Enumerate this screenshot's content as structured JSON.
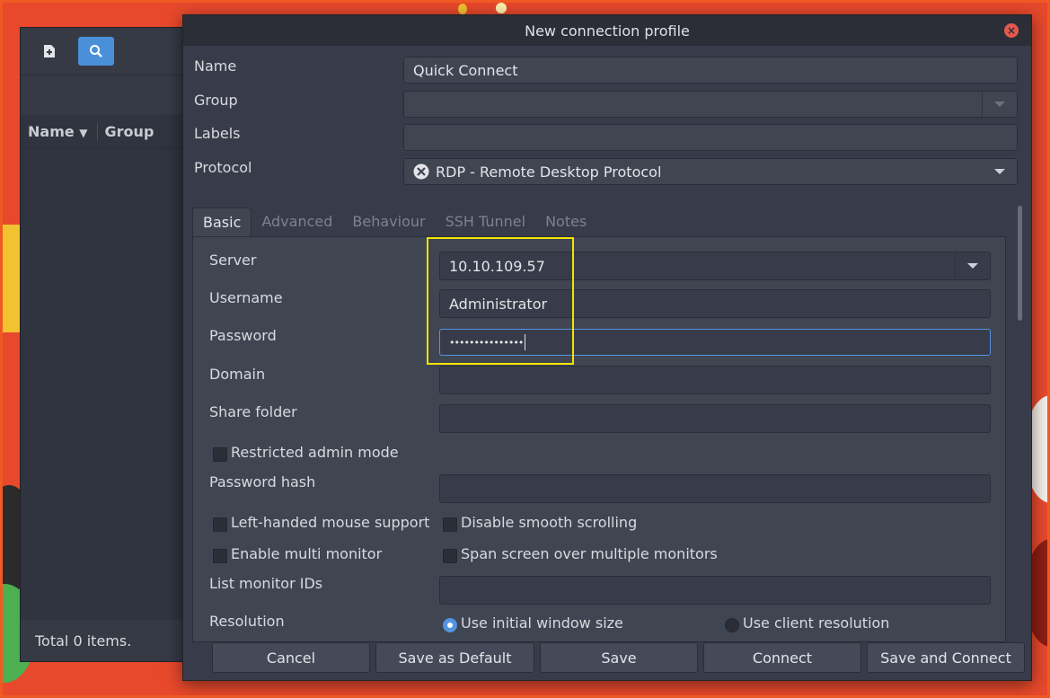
{
  "main_window": {
    "columns": [
      "Name",
      "Group"
    ],
    "status": "Total 0 items."
  },
  "dialog": {
    "title": "New connection profile",
    "fields": {
      "name_label": "Name",
      "name_value": "Quick Connect",
      "group_label": "Group",
      "group_value": "",
      "labels_label": "Labels",
      "labels_value": "",
      "protocol_label": "Protocol",
      "protocol_value": "RDP - Remote Desktop Protocol"
    },
    "tabs": [
      "Basic",
      "Advanced",
      "Behaviour",
      "SSH Tunnel",
      "Notes"
    ],
    "active_tab": "Basic",
    "basic": {
      "server_label": "Server",
      "server_value": "10.10.109.57",
      "username_label": "Username",
      "username_value": "Administrator",
      "password_label": "Password",
      "password_value": "•••••••••••••••",
      "domain_label": "Domain",
      "share_folder_label": "Share folder",
      "restricted_admin": "Restricted admin mode",
      "password_hash_label": "Password hash",
      "left_handed": "Left-handed mouse support",
      "disable_smooth": "Disable smooth scrolling",
      "multi_monitor": "Enable multi monitor",
      "span_screen": "Span screen over multiple monitors",
      "monitor_ids_label": "List monitor IDs",
      "resolution_label": "Resolution",
      "res_initial": "Use initial window size",
      "res_client": "Use client resolution"
    },
    "buttons": {
      "cancel": "Cancel",
      "save_default": "Save as Default",
      "save": "Save",
      "connect": "Connect",
      "save_connect": "Save and Connect"
    }
  },
  "colors": {
    "accent": "#5294e2",
    "highlight_box": "#f4e400",
    "close": "#e1594d",
    "desktop": "#e8492c"
  }
}
